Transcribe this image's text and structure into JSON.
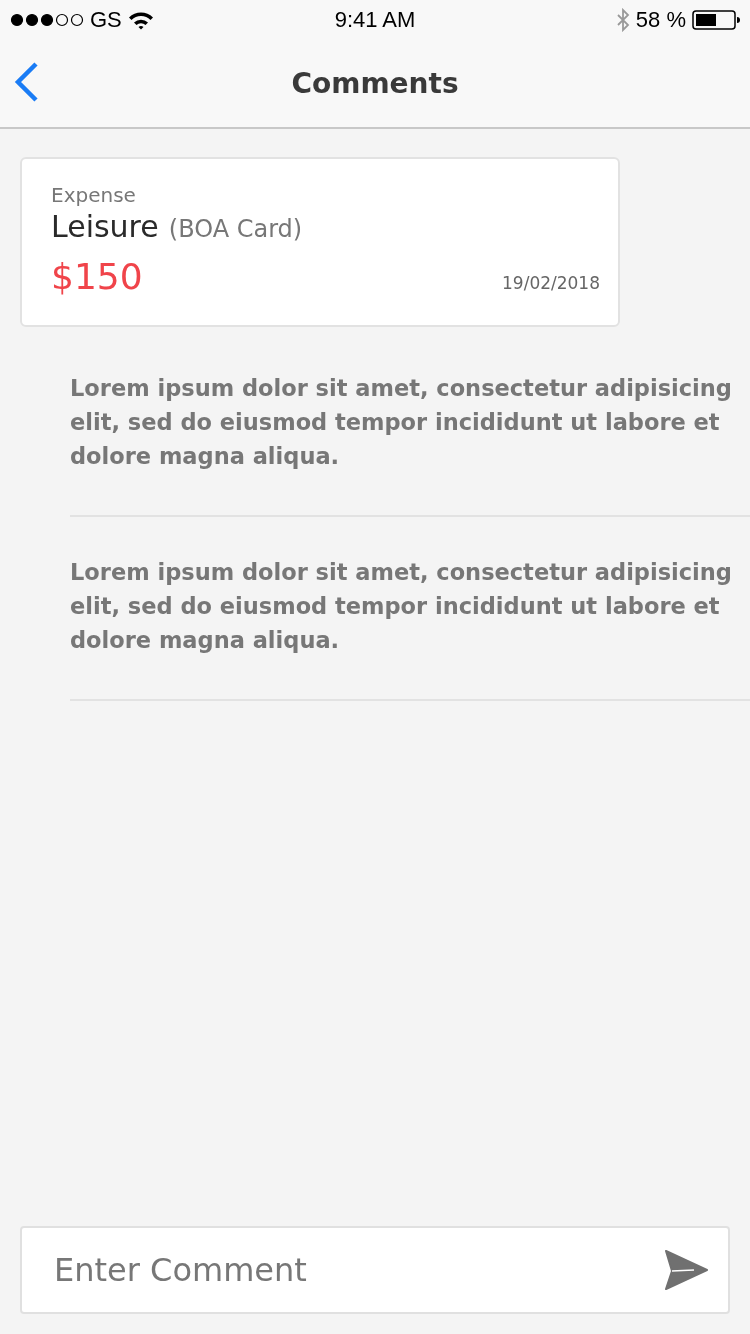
{
  "status_bar": {
    "carrier": "GS",
    "time": "9:41 AM",
    "battery": "58 %"
  },
  "nav": {
    "title": "Comments"
  },
  "expense": {
    "label": "Expense",
    "category": "Leisure",
    "account": "(BOA Card)",
    "amount": "$150",
    "date": "19/02/2018"
  },
  "comments": [
    {
      "text": "Lorem ipsum dolor sit amet, consectetur adipisicing elit, sed do eiusmod tempor incididunt ut labore et dolore magna aliqua."
    },
    {
      "text": "Lorem ipsum dolor sit amet, consectetur adipisicing elit, sed do eiusmod tempor incididunt ut labore et dolore magna aliqua."
    }
  ],
  "composer": {
    "placeholder": "Enter Comment"
  }
}
